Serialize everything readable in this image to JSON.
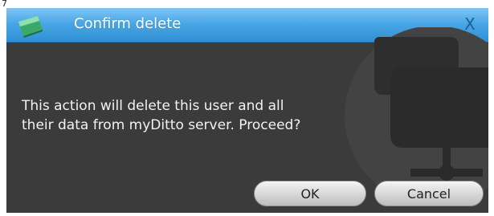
{
  "corner_mark": "7",
  "dialog": {
    "title": "Confirm delete",
    "close_label": "X",
    "icons": {
      "app": "mydittobox-icon",
      "watermark": "folder-network-icon",
      "close": "close-icon"
    },
    "message_lines": [
      "This action will delete this user and all",
      "their data from myDitto server. Proceed?"
    ],
    "buttons": {
      "ok": "OK",
      "cancel": "Cancel"
    }
  },
  "colors": {
    "titlebar": "#4aa7e6",
    "body": "#3b3b3b",
    "text": "#f2f2f2"
  }
}
